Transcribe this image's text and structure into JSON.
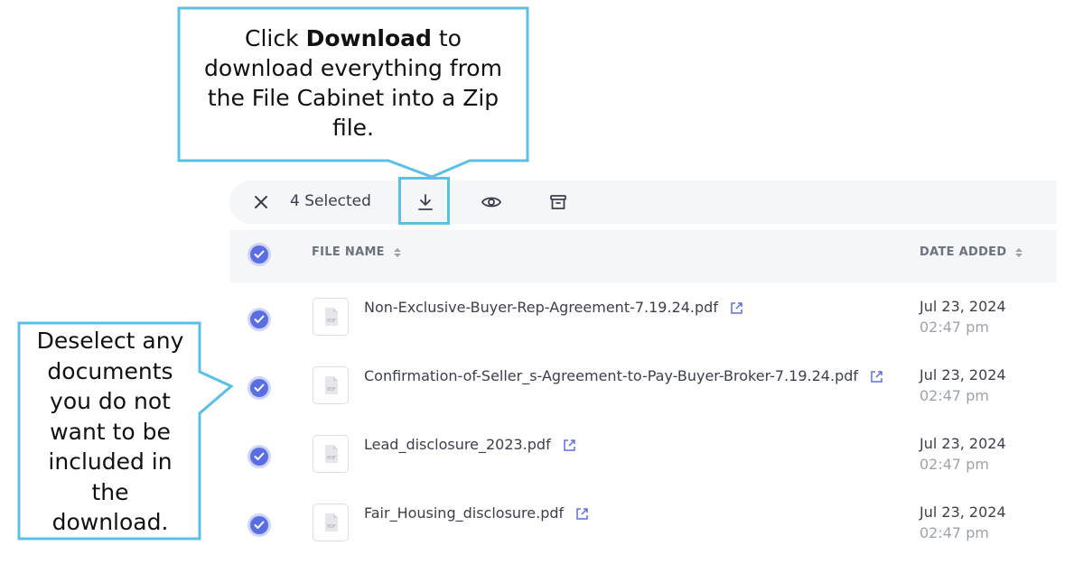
{
  "callout_top": {
    "line1_pre": "Click ",
    "line1_bold": "Download",
    "line1_post": " to",
    "line2": "download everything from",
    "line3": "the File Cabinet into a Zip",
    "line4": "file."
  },
  "callout_left": {
    "lines": [
      "Deselect any",
      "documents",
      "you do not",
      "want to be",
      "included in",
      "the",
      "download."
    ]
  },
  "toolbar": {
    "selected_label": "4 Selected",
    "icons": [
      "close-icon",
      "download-icon",
      "eye-icon",
      "archive-icon"
    ]
  },
  "table": {
    "col_file": "FILE NAME",
    "col_date": "DATE ADDED",
    "rows": [
      {
        "name": "Non-Exclusive-Buyer-Rep-Agreement-7.19.24.pdf",
        "date": "Jul 23, 2024",
        "time": "02:47 pm",
        "checked": true
      },
      {
        "name": "Confirmation-of-Seller_s-Agreement-to-Pay-Buyer-Broker-7.19.24.pdf",
        "date": "Jul 23, 2024",
        "time": "02:47 pm",
        "checked": true
      },
      {
        "name": "Lead_disclosure_2023.pdf",
        "date": "Jul 23, 2024",
        "time": "02:47 pm",
        "checked": true
      },
      {
        "name": "Fair_Housing_disclosure.pdf",
        "date": "Jul 23, 2024",
        "time": "02:47 pm",
        "checked": true
      }
    ]
  },
  "colors": {
    "accent": "#5b6ee1",
    "callout_border": "#5bc0e8"
  }
}
